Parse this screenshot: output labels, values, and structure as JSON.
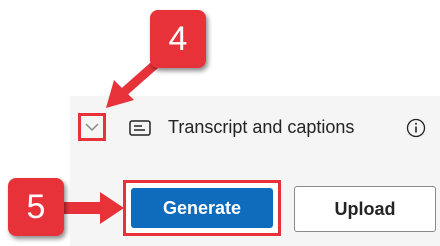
{
  "transcript": {
    "title": "Transcript and captions",
    "expand_icon": "chevron-down-icon",
    "caption_icon": "closed-caption-icon",
    "info_icon": "info-circle-icon"
  },
  "actions": {
    "generate_label": "Generate",
    "upload_label": "Upload"
  },
  "annotations": {
    "step_4": "4",
    "step_5": "5",
    "highlight_color": "#e8323a"
  },
  "colors": {
    "primary": "#0f6cbd",
    "panel_background": "#f5f5f5"
  }
}
